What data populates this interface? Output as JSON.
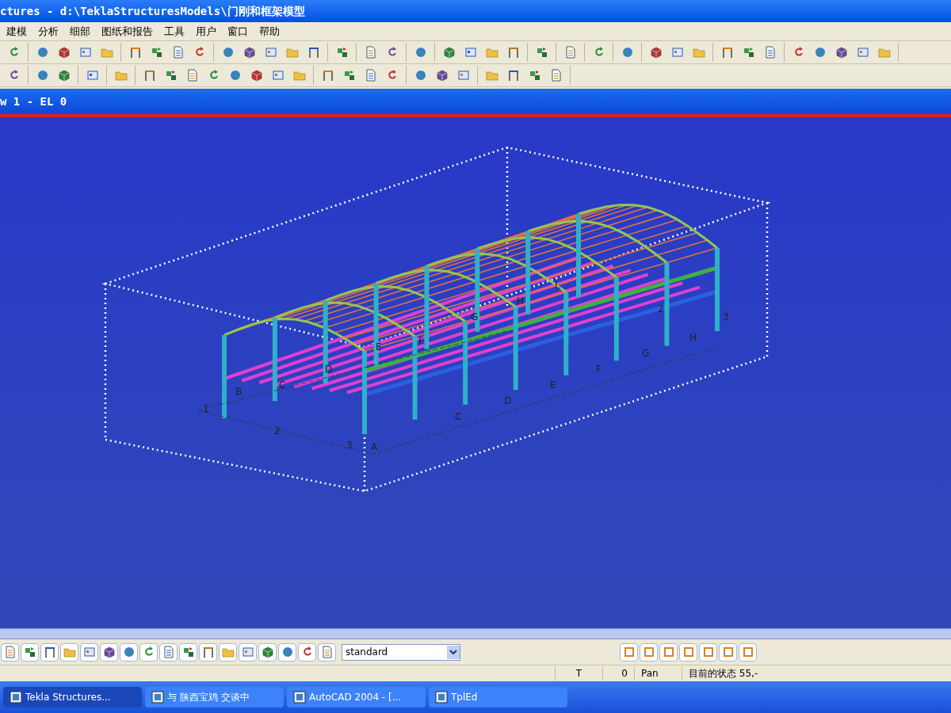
{
  "window": {
    "title": "ctures - d:\\TeklaStructuresModels\\门刚和框架模型"
  },
  "menu": [
    "建模",
    "分析",
    "细部",
    "图纸和报告",
    "工具",
    "用户",
    "窗口",
    "帮助"
  ],
  "view": {
    "title": "w 1 - EL 0",
    "grid_labels": [
      "A",
      "B",
      "C",
      "D",
      "E",
      "F",
      "G",
      "H",
      "L",
      "1",
      "2",
      "3",
      "C",
      "D",
      "E",
      "F",
      "G",
      "H",
      "2",
      "3"
    ]
  },
  "bottom_toolbar": {
    "filter_select": {
      "value": "standard"
    }
  },
  "status_bar": [
    "T",
    "0",
    "Pan",
    "目前的状态 55,-"
  ],
  "taskbar": [
    {
      "label": "Tekla Structures...",
      "selected": true
    },
    {
      "label": "与 陕西宝鸡 交谈中",
      "selected": false
    },
    {
      "label": "AutoCAD 2004 - [...",
      "selected": false
    },
    {
      "label": "TplEd",
      "selected": false
    }
  ]
}
